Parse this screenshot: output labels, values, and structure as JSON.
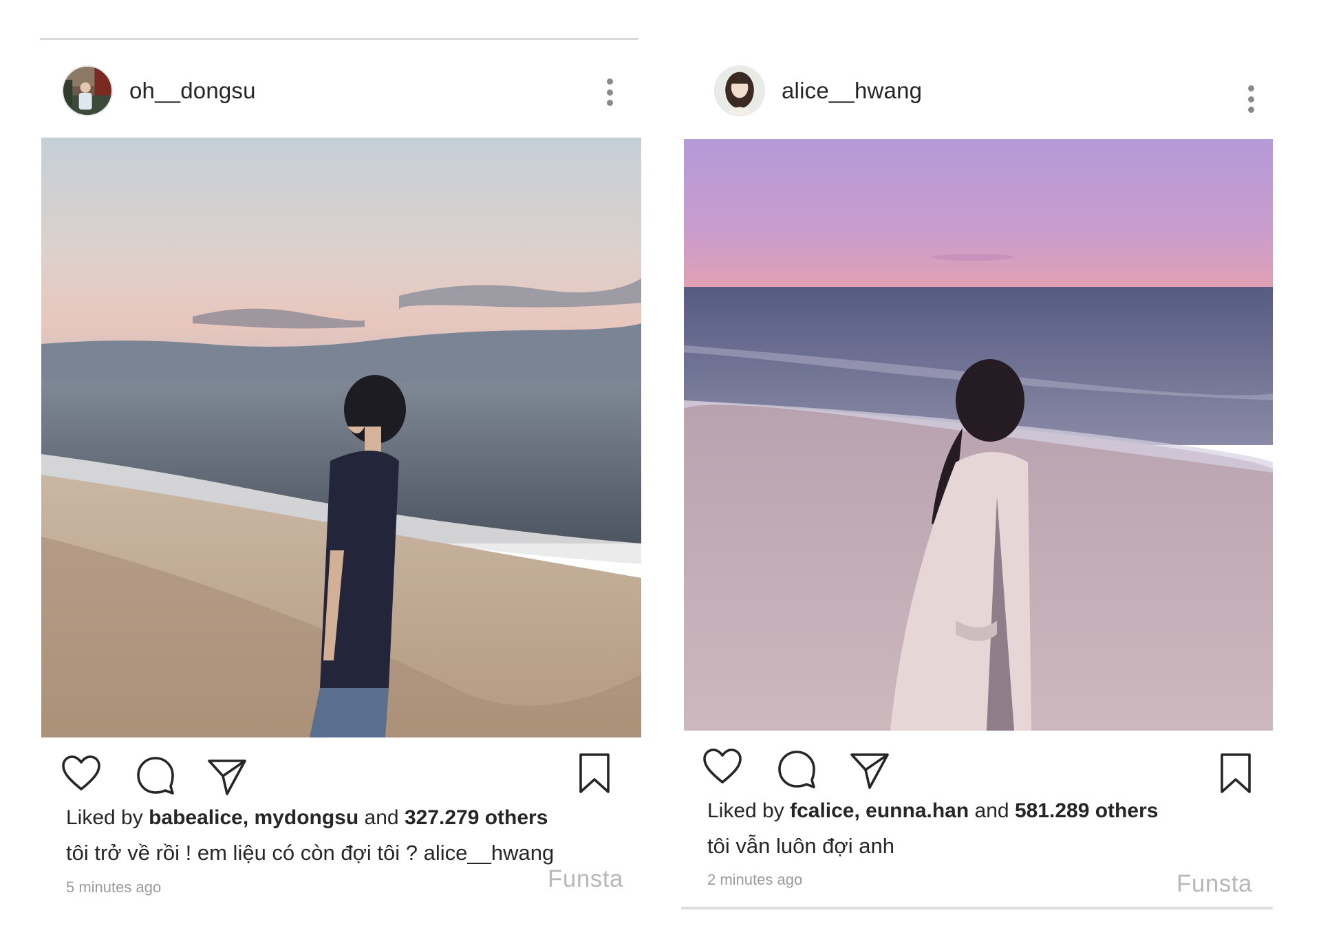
{
  "posts": [
    {
      "username": "oh__dongsu",
      "liked_prefix": "Liked by",
      "liked_users": "babealice, mydongsu",
      "liked_and": "and",
      "liked_count": "327.279 others",
      "caption": "tôi trở về rồi ! em liệu có còn đợi tôi ? alice__hwang",
      "timestamp": "5 minutes ago",
      "brand": "Funsta",
      "actions": [
        "heart-icon",
        "comment-icon",
        "share-icon",
        "bookmark-icon"
      ]
    },
    {
      "username": "alice__hwang",
      "liked_prefix": "Liked by",
      "liked_users": "fcalice, eunna.han",
      "liked_and": "and",
      "liked_count": "581.289 others",
      "caption": "tôi vẫn luôn đợi anh",
      "timestamp": "2 minutes ago",
      "brand": "Funsta",
      "actions": [
        "heart-icon",
        "comment-icon",
        "share-icon",
        "bookmark-icon"
      ]
    }
  ],
  "colors": {
    "text": "#262626",
    "muted": "#9a9a9a",
    "brand": "#b8b8b8",
    "icon_stroke": "#262626"
  }
}
